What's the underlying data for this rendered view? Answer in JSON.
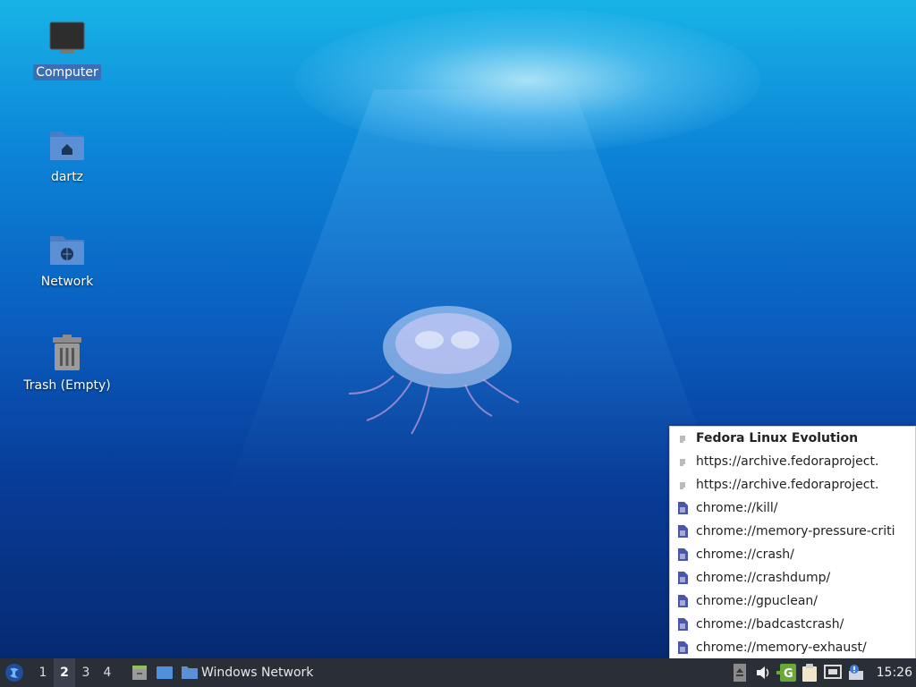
{
  "desktop": {
    "icons": [
      {
        "label": "Computer",
        "selected": true
      },
      {
        "label": "dartz",
        "selected": false
      },
      {
        "label": "Network",
        "selected": false
      },
      {
        "label": "Trash (Empty)",
        "selected": false
      }
    ]
  },
  "popup": {
    "items": [
      {
        "label": "Fedora Linux Evolution",
        "bold": true,
        "icon": "text-doc-icon"
      },
      {
        "label": "https://archive.fedoraproject.",
        "icon": "text-doc-icon"
      },
      {
        "label": "https://archive.fedoraproject.",
        "icon": "text-doc-icon"
      },
      {
        "label": "chrome://kill/",
        "icon": "page-icon"
      },
      {
        "label": "chrome://memory-pressure-criti",
        "icon": "page-icon"
      },
      {
        "label": "chrome://crash/",
        "icon": "page-icon"
      },
      {
        "label": "chrome://crashdump/",
        "icon": "page-icon"
      },
      {
        "label": "chrome://gpuclean/",
        "icon": "page-icon"
      },
      {
        "label": "chrome://badcastcrash/",
        "icon": "page-icon"
      },
      {
        "label": "chrome://memory-exhaust/",
        "icon": "page-icon"
      }
    ]
  },
  "panel": {
    "workspaces": [
      "1",
      "2",
      "3",
      "4"
    ],
    "active_workspace": "2",
    "task_label": "Windows Network",
    "clock": "15:26"
  },
  "colors": {
    "panel": "#2a2e36",
    "selection": "#3a6fb8",
    "folder": "#5b8fd6"
  }
}
